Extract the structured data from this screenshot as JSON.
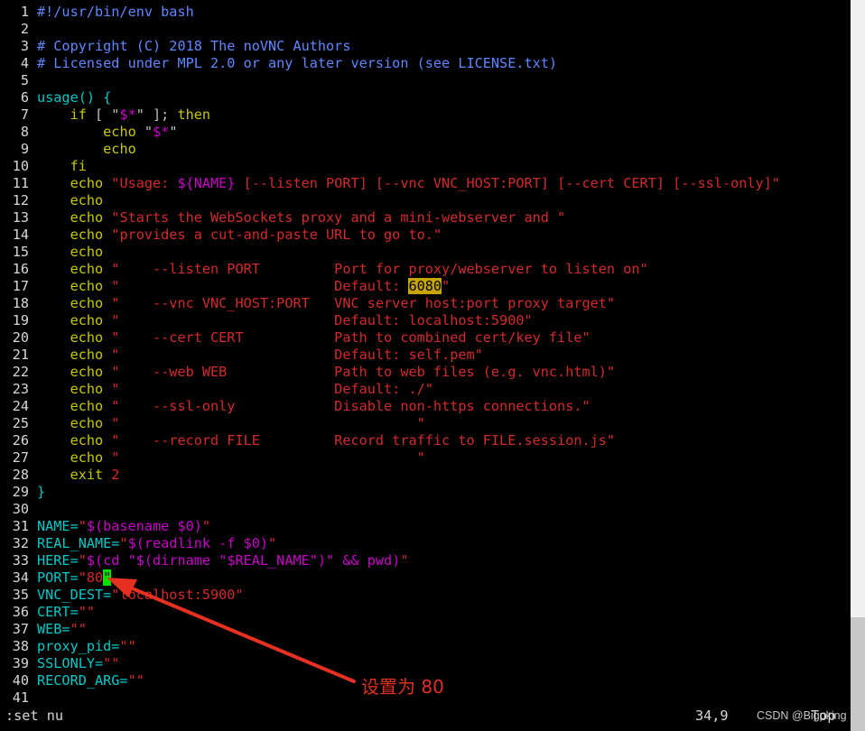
{
  "editor": {
    "lines": [
      {
        "n": "1",
        "segs": [
          [
            "#!/usr/bin/env bash",
            "comment"
          ]
        ]
      },
      {
        "n": "2",
        "segs": []
      },
      {
        "n": "3",
        "segs": [
          [
            "# Copyright (C) 2018 The noVNC Authors",
            "comment"
          ]
        ]
      },
      {
        "n": "4",
        "segs": [
          [
            "# Licensed under MPL 2.0 or any later version (see LICENSE.txt)",
            "comment"
          ]
        ]
      },
      {
        "n": "5",
        "segs": []
      },
      {
        "n": "6",
        "segs": [
          [
            "usage() {",
            "fn"
          ]
        ]
      },
      {
        "n": "7",
        "segs": [
          [
            "    ",
            "plain"
          ],
          [
            "if",
            "kw"
          ],
          [
            " [ \"",
            "plain"
          ],
          [
            "$*",
            "var"
          ],
          [
            "\" ]; ",
            "plain"
          ],
          [
            "then",
            "kw"
          ]
        ]
      },
      {
        "n": "8",
        "segs": [
          [
            "        ",
            "plain"
          ],
          [
            "echo",
            "kw"
          ],
          [
            " \"",
            "plain"
          ],
          [
            "$*",
            "var"
          ],
          [
            "\"",
            "plain"
          ]
        ]
      },
      {
        "n": "9",
        "segs": [
          [
            "        ",
            "plain"
          ],
          [
            "echo",
            "kw"
          ]
        ]
      },
      {
        "n": "10",
        "segs": [
          [
            "    ",
            "plain"
          ],
          [
            "fi",
            "kw"
          ]
        ]
      },
      {
        "n": "11",
        "segs": [
          [
            "    ",
            "plain"
          ],
          [
            "echo",
            "kw"
          ],
          [
            " \"Usage: ",
            "str"
          ],
          [
            "${NAME}",
            "var"
          ],
          [
            " [--listen PORT] [--vnc VNC_HOST:PORT] [--cert CERT] [--ssl-only]\"",
            "str"
          ]
        ]
      },
      {
        "n": "12",
        "segs": [
          [
            "    ",
            "plain"
          ],
          [
            "echo",
            "kw"
          ]
        ]
      },
      {
        "n": "13",
        "segs": [
          [
            "    ",
            "plain"
          ],
          [
            "echo",
            "kw"
          ],
          [
            " \"Starts the WebSockets proxy and a mini-webserver and \"",
            "str"
          ]
        ]
      },
      {
        "n": "14",
        "segs": [
          [
            "    ",
            "plain"
          ],
          [
            "echo",
            "kw"
          ],
          [
            " \"provides a cut-and-paste URL to go to.\"",
            "str"
          ]
        ]
      },
      {
        "n": "15",
        "segs": [
          [
            "    ",
            "plain"
          ],
          [
            "echo",
            "kw"
          ]
        ]
      },
      {
        "n": "16",
        "segs": [
          [
            "    ",
            "plain"
          ],
          [
            "echo",
            "kw"
          ],
          [
            " \"    --listen PORT         Port for proxy/webserver to listen on\"",
            "str"
          ]
        ]
      },
      {
        "n": "17",
        "segs": [
          [
            "    ",
            "plain"
          ],
          [
            "echo",
            "kw"
          ],
          [
            " \"                          Default: ",
            "str"
          ],
          [
            "6080",
            "hl"
          ],
          [
            "\"",
            "str"
          ]
        ]
      },
      {
        "n": "18",
        "segs": [
          [
            "    ",
            "plain"
          ],
          [
            "echo",
            "kw"
          ],
          [
            " \"    --vnc VNC_HOST:PORT   VNC server host:port proxy target\"",
            "str"
          ]
        ]
      },
      {
        "n": "19",
        "segs": [
          [
            "    ",
            "plain"
          ],
          [
            "echo",
            "kw"
          ],
          [
            " \"                          Default: localhost:5900\"",
            "str"
          ]
        ]
      },
      {
        "n": "20",
        "segs": [
          [
            "    ",
            "plain"
          ],
          [
            "echo",
            "kw"
          ],
          [
            " \"    --cert CERT           Path to combined cert/key file\"",
            "str"
          ]
        ]
      },
      {
        "n": "21",
        "segs": [
          [
            "    ",
            "plain"
          ],
          [
            "echo",
            "kw"
          ],
          [
            " \"                          Default: self.pem\"",
            "str"
          ]
        ]
      },
      {
        "n": "22",
        "segs": [
          [
            "    ",
            "plain"
          ],
          [
            "echo",
            "kw"
          ],
          [
            " \"    --web WEB             Path to web files (e.g. vnc.html)\"",
            "str"
          ]
        ]
      },
      {
        "n": "23",
        "segs": [
          [
            "    ",
            "plain"
          ],
          [
            "echo",
            "kw"
          ],
          [
            " \"                          Default: ./\"",
            "str"
          ]
        ]
      },
      {
        "n": "24",
        "segs": [
          [
            "    ",
            "plain"
          ],
          [
            "echo",
            "kw"
          ],
          [
            " \"    --ssl-only            Disable non-https connections.\"",
            "str"
          ]
        ]
      },
      {
        "n": "25",
        "segs": [
          [
            "    ",
            "plain"
          ],
          [
            "echo",
            "kw"
          ],
          [
            " \"                                    \"",
            "str"
          ]
        ]
      },
      {
        "n": "26",
        "segs": [
          [
            "    ",
            "plain"
          ],
          [
            "echo",
            "kw"
          ],
          [
            " \"    --record FILE         Record traffic to FILE.session.js\"",
            "str"
          ]
        ]
      },
      {
        "n": "27",
        "segs": [
          [
            "    ",
            "plain"
          ],
          [
            "echo",
            "kw"
          ],
          [
            " \"                                    \"",
            "str"
          ]
        ]
      },
      {
        "n": "28",
        "segs": [
          [
            "    ",
            "plain"
          ],
          [
            "exit",
            "kw"
          ],
          [
            " 2",
            "str"
          ]
        ]
      },
      {
        "n": "29",
        "segs": [
          [
            "}",
            "fn"
          ]
        ]
      },
      {
        "n": "30",
        "segs": []
      },
      {
        "n": "31",
        "segs": [
          [
            "NAME=",
            "fn"
          ],
          [
            "\"",
            "str"
          ],
          [
            "$(basename $0)",
            "var"
          ],
          [
            "\"",
            "str"
          ]
        ]
      },
      {
        "n": "32",
        "segs": [
          [
            "REAL_NAME=",
            "fn"
          ],
          [
            "\"",
            "str"
          ],
          [
            "$(readlink -f $0)",
            "var"
          ],
          [
            "\"",
            "str"
          ]
        ]
      },
      {
        "n": "33",
        "segs": [
          [
            "HERE=",
            "fn"
          ],
          [
            "\"",
            "str"
          ],
          [
            "$(cd \"$(dirname \"$REAL_NAME\")\" && pwd)",
            "var"
          ],
          [
            "\"",
            "str"
          ]
        ]
      },
      {
        "n": "34",
        "segs": [
          [
            "PORT=",
            "fn"
          ],
          [
            "\"80",
            "str"
          ],
          [
            "\"",
            "cursor"
          ]
        ]
      },
      {
        "n": "35",
        "segs": [
          [
            "VNC_DEST=",
            "fn"
          ],
          [
            "\"localhost:5900\"",
            "str"
          ]
        ]
      },
      {
        "n": "36",
        "segs": [
          [
            "CERT=",
            "fn"
          ],
          [
            "\"\"",
            "str"
          ]
        ]
      },
      {
        "n": "37",
        "segs": [
          [
            "WEB=",
            "fn"
          ],
          [
            "\"\"",
            "str"
          ]
        ]
      },
      {
        "n": "38",
        "segs": [
          [
            "proxy_pid=",
            "fn"
          ],
          [
            "\"\"",
            "str"
          ]
        ]
      },
      {
        "n": "39",
        "segs": [
          [
            "SSLONLY=",
            "fn"
          ],
          [
            "\"\"",
            "str"
          ]
        ]
      },
      {
        "n": "40",
        "segs": [
          [
            "RECORD_ARG=",
            "fn"
          ],
          [
            "\"\"",
            "str"
          ]
        ]
      },
      {
        "n": "41",
        "segs": []
      }
    ]
  },
  "statusbar": {
    "command": ":set nu",
    "ruler": "34,9",
    "position": "Top"
  },
  "watermark": "CSDN @Bigpking",
  "annotation": {
    "text": "设置为 80",
    "color": "#e03020"
  },
  "colors": {
    "background": "#000000",
    "comment": "#5f87ff",
    "function": "#00c8c8",
    "string": "#d22a2a",
    "variable": "#c800c8",
    "keyword": "#c8c800",
    "search_highlight": "#c8a400",
    "cursor": "#00e000"
  }
}
